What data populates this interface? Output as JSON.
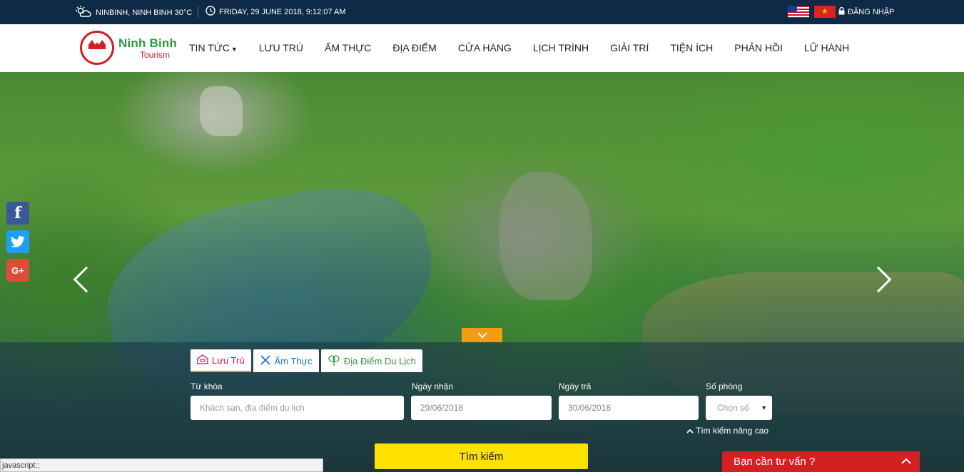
{
  "topbar": {
    "weather": "NINBINH, NINH BINH 30°C",
    "datetime": "FRIDAY, 29 JUNE 2018, 9:12:07 AM",
    "login": "ĐĂNG NHẬP"
  },
  "logo": {
    "title": "Ninh Binh",
    "subtitle": "Tourism"
  },
  "menu": [
    "TIN TỨC",
    "LƯU TRÚ",
    "ẨM THỰC",
    "ĐỊA ĐIỂM",
    "CỬA HÀNG",
    "LỊCH TRÌNH",
    "GIẢI TRÍ",
    "TIỆN ÍCH",
    "PHẢN HỒI",
    "LỮ HÀNH"
  ],
  "search": {
    "tabs": [
      "Lưu Trú",
      "Ẩm Thực",
      "Địa Điểm Du Lịch"
    ],
    "keyword_label": "Từ khóa",
    "keyword_placeholder": "Khách sạn, địa điểm du lịch",
    "checkin_label": "Ngày nhận",
    "checkin_value": "29/06/2018",
    "checkout_label": "Ngày trả",
    "checkout_value": "30/06/2018",
    "rooms_label": "Số phòng",
    "rooms_value": "Chọn số",
    "advanced": "Tìm kiếm nâng cao",
    "submit": "Tìm kiếm"
  },
  "status_bar": "javascript:;",
  "consult": "Bạn cần tư vấn ?",
  "colors": {
    "topbar": "#0e2a47",
    "search_button": "#ffe100",
    "consult": "#d32020",
    "tab_active": "#c2185b"
  }
}
